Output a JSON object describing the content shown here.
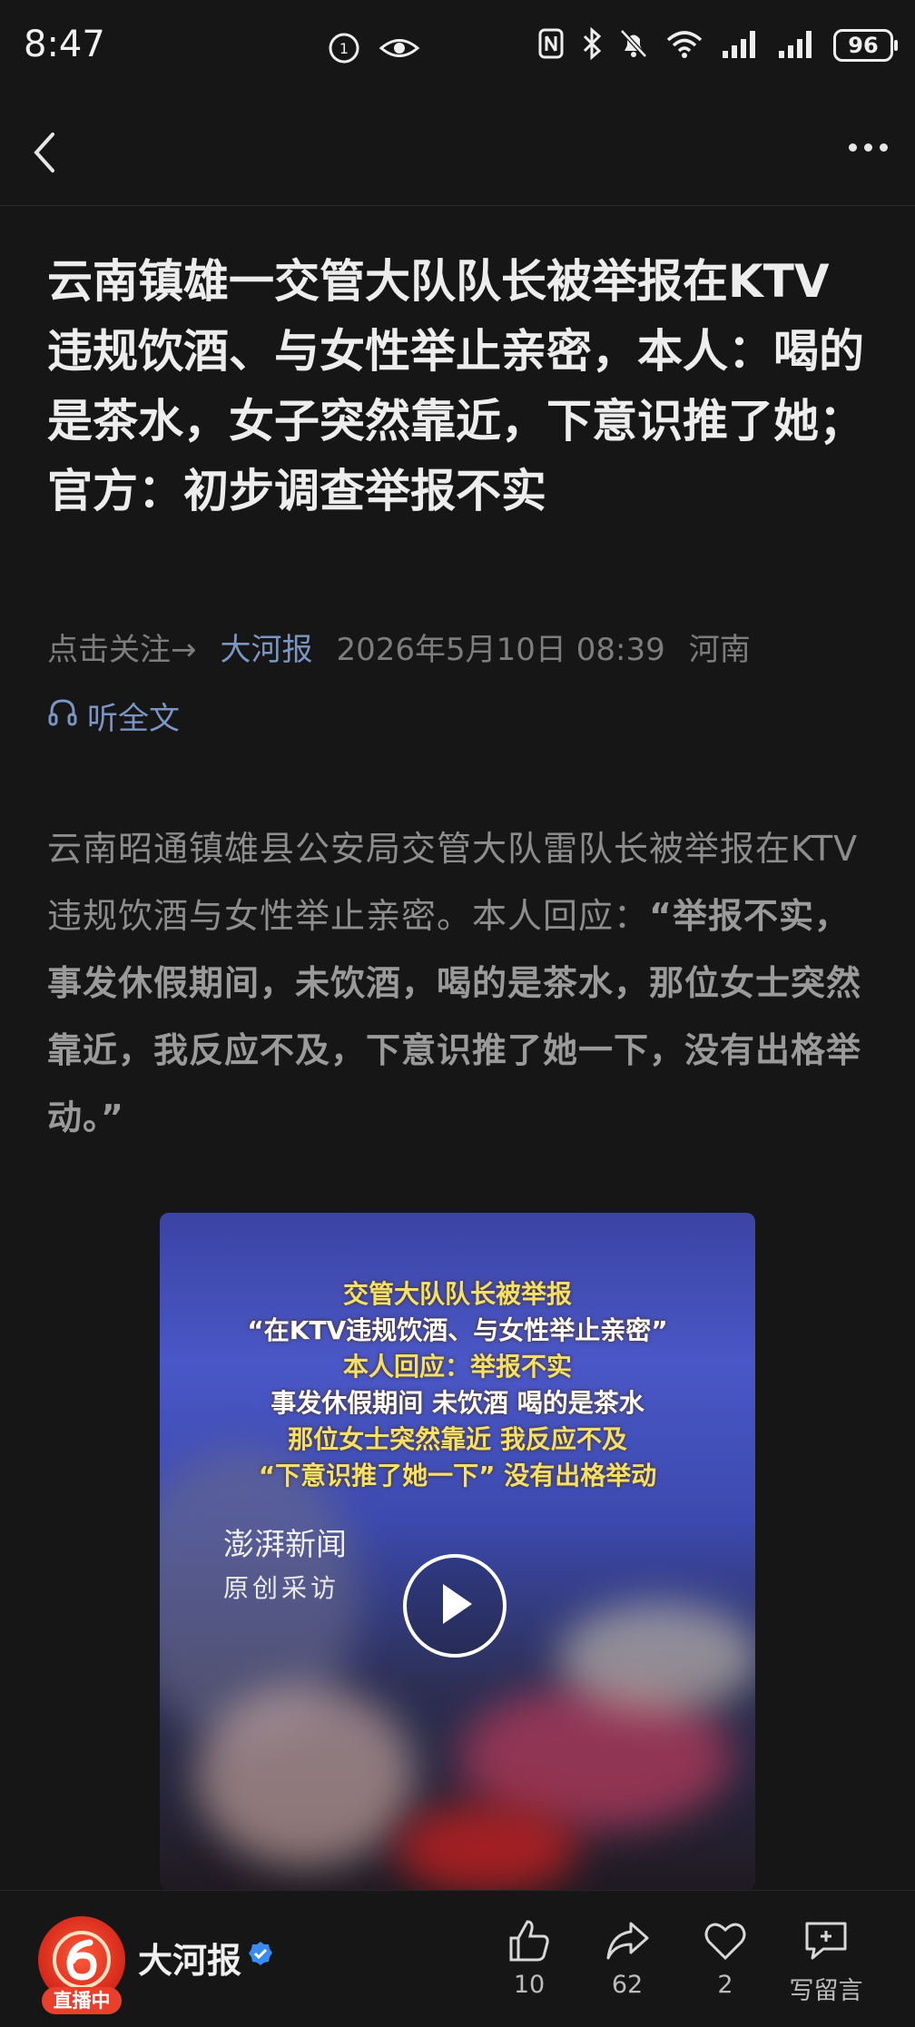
{
  "status_bar": {
    "time": "8:47",
    "battery": "96"
  },
  "article": {
    "headline": "云南镇雄一交管大队队长被举报在KTV违规饮酒、与女性举止亲密，本人：喝的是茶水，女子突然靠近，下意识推了她；官方：初步调查举报不实",
    "follow_prompt": "点击关注→",
    "source": "大河报",
    "datetime": "2026年5月10日 08:39",
    "location": "河南",
    "listen_label": "听全文",
    "body_plain": "云南昭通镇雄县公安局交管大队雷队长被举报在KTV违规饮酒与女性举止亲密。本人回应：",
    "body_quote": "“举报不实，事发休假期间，未饮酒，喝的是茶水，那位女士突然靠近，我反应不及，下意识推了她一下，没有出格举动。”"
  },
  "video": {
    "caption_lines": [
      "交管大队队长被举报",
      "“在KTV违规饮酒、与女性举止亲密”",
      "本人回应：举报不实",
      "事发休假期间 未饮酒 喝的是茶水",
      "那位女士突然靠近 我反应不及",
      "“下意识推了她一下” 没有出格举动"
    ],
    "brand": "澎湃新闻",
    "brand_sub": "原创采访"
  },
  "bottom_bar": {
    "publisher": "大河报",
    "live_badge": "直播中",
    "like_count": "10",
    "share_count": "62",
    "fav_count": "2",
    "comment_label": "写留言"
  }
}
